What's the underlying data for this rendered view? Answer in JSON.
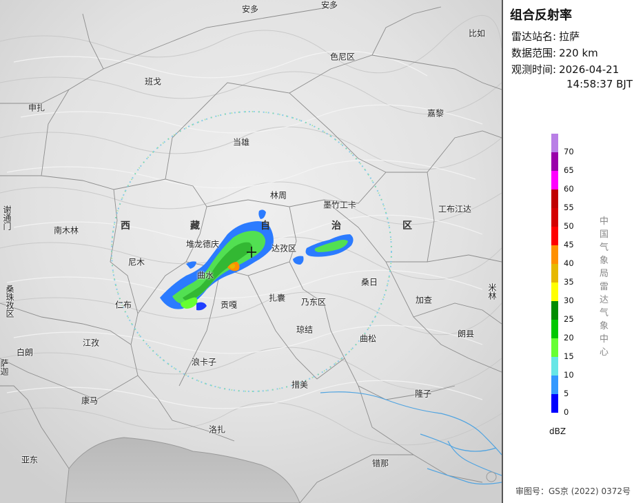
{
  "map": {
    "regions": [
      {
        "id": "xi",
        "text": "西"
      },
      {
        "id": "zang",
        "text": "藏"
      },
      {
        "id": "zi",
        "text": "自"
      },
      {
        "id": "zhi",
        "text": "治"
      },
      {
        "id": "qu",
        "text": "区"
      }
    ],
    "places": [
      "安多",
      "安多",
      "比如",
      "色尼区",
      "班戈",
      "申扎",
      "嘉黎",
      "当雄",
      "林周",
      "墨竹工卡",
      "工布江达",
      "南木林",
      "堆龙德庆",
      "达孜区",
      "尼木",
      "曲水",
      "贡嘎",
      "扎囊",
      "乃东区",
      "桑日",
      "加查",
      "仁布",
      "琼结",
      "曲松",
      "朗县",
      "江孜",
      "白朗",
      "浪卡子",
      "措美",
      "隆子",
      "康马",
      "洛扎",
      "亚东",
      "错那",
      "谢通门",
      "桑珠孜区",
      "米林",
      "萨迦"
    ],
    "station_marker": "radar-station"
  },
  "panel": {
    "title": "组合反射率",
    "station_label": "雷达站名:",
    "station_value": "拉萨",
    "range_label": "数据范围:",
    "range_value": "220 km",
    "time_label": "观测时间:",
    "time_date": "2026-04-21",
    "time_clock": "14:58:37 BJT",
    "credit": "中国气象局雷达气象中心",
    "unit": "dBZ",
    "approval": "审图号：GS京 (2022) 0372号"
  },
  "legend": {
    "ticks": [
      "70",
      "65",
      "60",
      "55",
      "50",
      "45",
      "40",
      "35",
      "30",
      "25",
      "20",
      "15",
      "10",
      "5",
      "0"
    ],
    "colors": [
      "#b97fe6",
      "#9a00aa",
      "#ff00ff",
      "#c00000",
      "#d40000",
      "#ff0000",
      "#ff9000",
      "#e6b800",
      "#ffff00",
      "#008c00",
      "#00c800",
      "#66ff33",
      "#66e6e6",
      "#3399ff",
      "#0000ff"
    ]
  }
}
